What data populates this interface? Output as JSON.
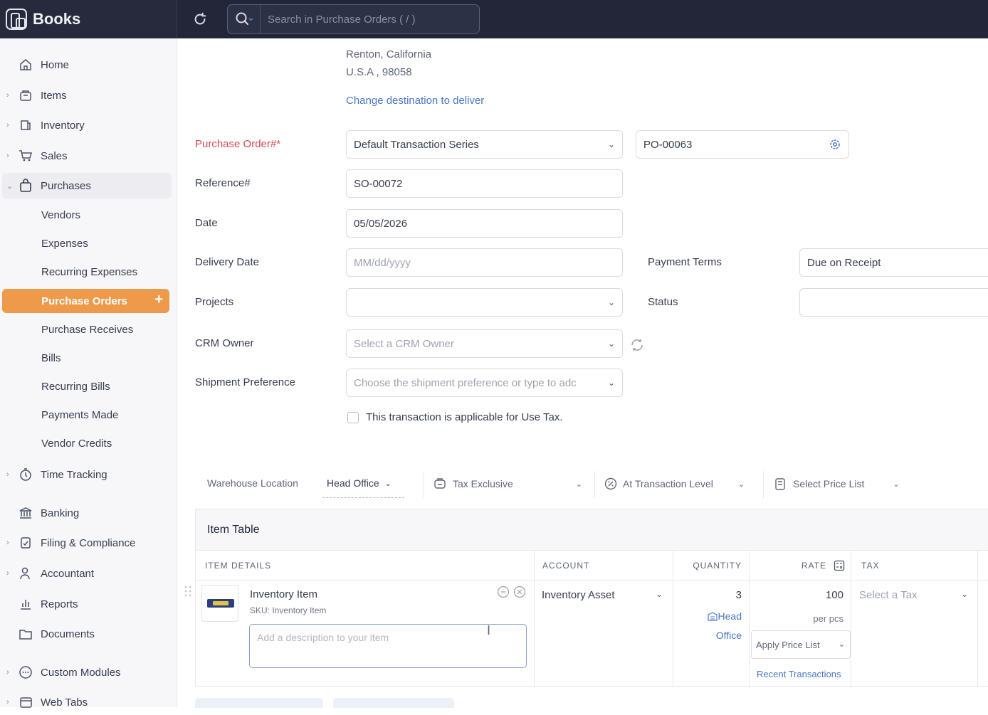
{
  "topbar": {
    "app_name": "Books",
    "search_placeholder": "Search in Purchase Orders ( / )"
  },
  "sidebar": {
    "items": [
      {
        "label": "Home",
        "icon": "home-icon"
      },
      {
        "label": "Items",
        "icon": "box-icon"
      },
      {
        "label": "Inventory",
        "icon": "inventory-icon"
      },
      {
        "label": "Sales",
        "icon": "cart-icon"
      },
      {
        "label": "Purchases",
        "icon": "bag-icon"
      },
      {
        "label": "Time Tracking",
        "icon": "clock-icon"
      },
      {
        "label": "Banking",
        "icon": "bank-icon"
      },
      {
        "label": "Filing & Compliance",
        "icon": "filing-icon"
      },
      {
        "label": "Accountant",
        "icon": "user-icon"
      },
      {
        "label": "Reports",
        "icon": "chart-icon"
      },
      {
        "label": "Documents",
        "icon": "folder-icon"
      },
      {
        "label": "Custom Modules",
        "icon": "modules-icon"
      },
      {
        "label": "Web Tabs",
        "icon": "webtab-icon"
      }
    ],
    "purchase_subitems": [
      "Vendors",
      "Expenses",
      "Recurring Expenses",
      "Purchase Orders",
      "Purchase Receives",
      "Bills",
      "Recurring Bills",
      "Payments Made",
      "Vendor Credits"
    ],
    "active_plus": "+"
  },
  "address": {
    "line1": "Renton, California",
    "line2": "U.S.A , 98058",
    "change_link": "Change destination to deliver"
  },
  "form": {
    "po_label": "Purchase Order#*",
    "po_series": "Default Transaction Series",
    "po_number": "PO-00063",
    "ref_label": "Reference#",
    "ref_value": "SO-00072",
    "date_label": "Date",
    "date_value": "05/05/2026",
    "delivery_label": "Delivery Date",
    "delivery_placeholder": "MM/dd/yyyy",
    "payment_terms_label": "Payment Terms",
    "payment_terms_value": "Due on Receipt",
    "projects_label": "Projects",
    "status_label": "Status",
    "crm_label": "CRM Owner",
    "crm_placeholder": "Select a CRM Owner",
    "shipment_label": "Shipment Preference",
    "shipment_placeholder": "Choose the shipment preference or type to adc",
    "use_tax_label": "This transaction is applicable for Use Tax."
  },
  "toolbar": {
    "warehouse_label": "Warehouse Location",
    "warehouse_value": "Head Office",
    "tax_mode": "Tax Exclusive",
    "discount_level": "At Transaction Level",
    "price_list": "Select Price List"
  },
  "item_table": {
    "title": "Item Table",
    "columns": [
      "ITEM DETAILS",
      "ACCOUNT",
      "QUANTITY",
      "RATE",
      "TAX"
    ],
    "row": {
      "name": "Inventory Item",
      "sku": "SKU: Inventory Item",
      "description_placeholder": "Add a description to your item",
      "account": "Inventory Asset",
      "quantity": "3",
      "location_line1": "Head",
      "location_line2": "Office",
      "rate": "100",
      "unit": "per pcs",
      "apply_price_list": "Apply Price List",
      "recent_transactions": "Recent Transactions",
      "tax_placeholder": "Select a Tax"
    }
  },
  "colors": {
    "topbar": "#222638",
    "accent": "#ee9a4a",
    "link": "#4b76c8",
    "required": "#d6494f"
  }
}
